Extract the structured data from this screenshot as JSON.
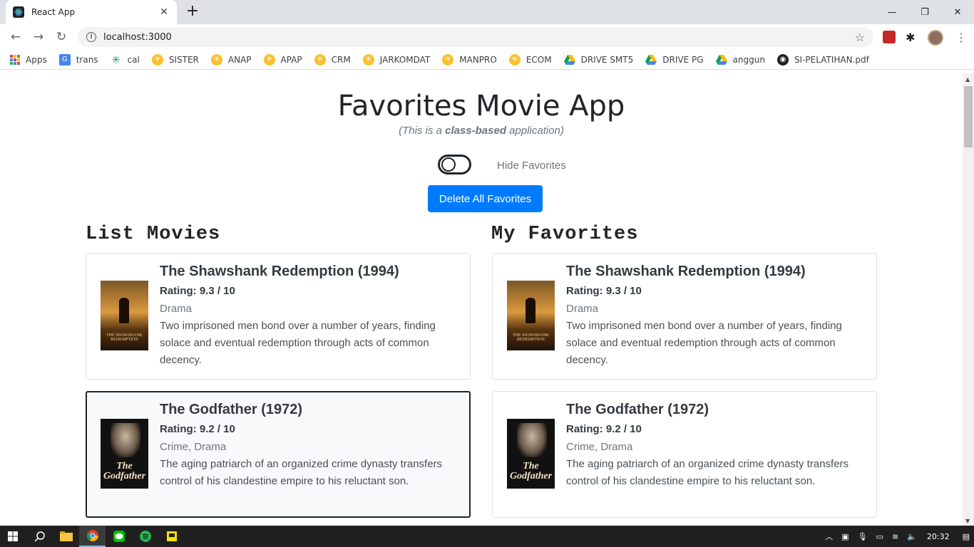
{
  "browser": {
    "tab_title": "React App",
    "url": "localhost:3000",
    "bookmarks": [
      {
        "label": "Apps",
        "icon": "apps-grid-icon"
      },
      {
        "label": "trans",
        "icon": "translate-icon"
      },
      {
        "label": "cal",
        "icon": "calendar-icon"
      },
      {
        "label": "SISTER",
        "icon": "university-logo-icon"
      },
      {
        "label": "ANAP",
        "icon": "university-logo-icon"
      },
      {
        "label": "APAP",
        "icon": "university-logo-icon"
      },
      {
        "label": "CRM",
        "icon": "university-logo-icon"
      },
      {
        "label": "JARKOMDAT",
        "icon": "university-logo-icon"
      },
      {
        "label": "MANPRO",
        "icon": "university-logo-icon"
      },
      {
        "label": "ECOM",
        "icon": "university-logo-icon"
      },
      {
        "label": "DRIVE SMT5",
        "icon": "google-drive-icon"
      },
      {
        "label": "DRIVE PG",
        "icon": "google-drive-icon"
      },
      {
        "label": "anggun",
        "icon": "google-drive-icon"
      },
      {
        "label": "SI-PELATIHAN.pdf",
        "icon": "globe-icon"
      }
    ]
  },
  "app": {
    "title": "Favorites Movie App",
    "subtitle_prefix": "(This is a ",
    "subtitle_bold": "class-based",
    "subtitle_suffix": " application)",
    "toggle_label": "Hide Favorites",
    "delete_button": "Delete All Favorites"
  },
  "list_movies": {
    "heading": "List Movies",
    "items": [
      {
        "title": "The Shawshank Redemption (1994)",
        "rating": "Rating: 9.3 / 10",
        "genre": "Drama",
        "description": "Two imprisoned men bond over a number of years, finding solace and eventual redemption through acts of common decency."
      },
      {
        "title": "The Godfather (1972)",
        "rating": "Rating: 9.2 / 10",
        "genre": "Crime, Drama",
        "description": "The aging patriarch of an organized crime dynasty transfers control of his clandestine empire to his reluctant son."
      }
    ]
  },
  "my_favorites": {
    "heading": "My Favorites",
    "items": [
      {
        "title": "The Shawshank Redemption (1994)",
        "rating": "Rating: 9.3 / 10",
        "genre": "Drama",
        "description": "Two imprisoned men bond over a number of years, finding solace and eventual redemption through acts of common decency."
      },
      {
        "title": "The Godfather (1972)",
        "rating": "Rating: 9.2 / 10",
        "genre": "Crime, Drama",
        "description": "The aging patriarch of an organized crime dynasty transfers control of his clandestine empire to his reluctant son."
      }
    ]
  },
  "posters": {
    "shawshank_text": "THE SHAWSHANK REDEMPTION",
    "godfather_text": "The Godfather"
  },
  "taskbar": {
    "time": "20:32"
  },
  "colors": {
    "primary": "#007bff",
    "active_card_border": "#212529"
  }
}
